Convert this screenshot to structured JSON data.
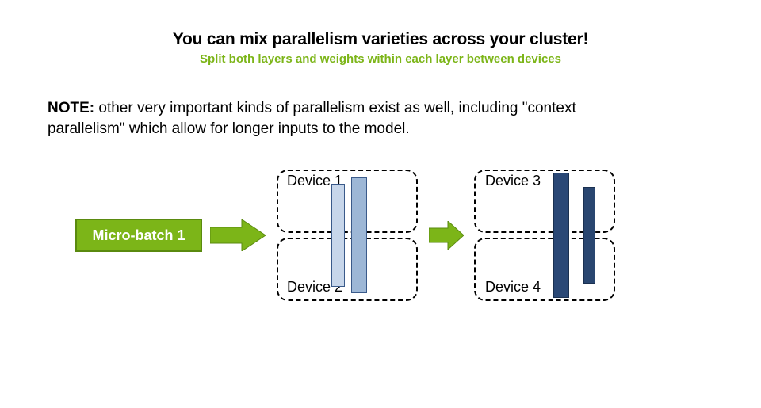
{
  "title": "You can mix parallelism varieties across your cluster!",
  "subtitle": "Split both layers and weights within each layer between devices",
  "note_label": "NOTE:",
  "note_body": " other very important kinds of parallelism exist as well, including \"context parallelism\" which allow for longer inputs to the model.",
  "microbatch_label": "Micro-batch 1",
  "devices": {
    "d1": "Device 1",
    "d2": "Device 2",
    "d3": "Device 3",
    "d4": "Device 4"
  },
  "colors": {
    "accent": "#7cb518",
    "accent_border": "#5a8a0f",
    "bar_light": "#c7d6ea",
    "bar_mid": "#9db7d6",
    "bar_dark": "#2a4876"
  }
}
